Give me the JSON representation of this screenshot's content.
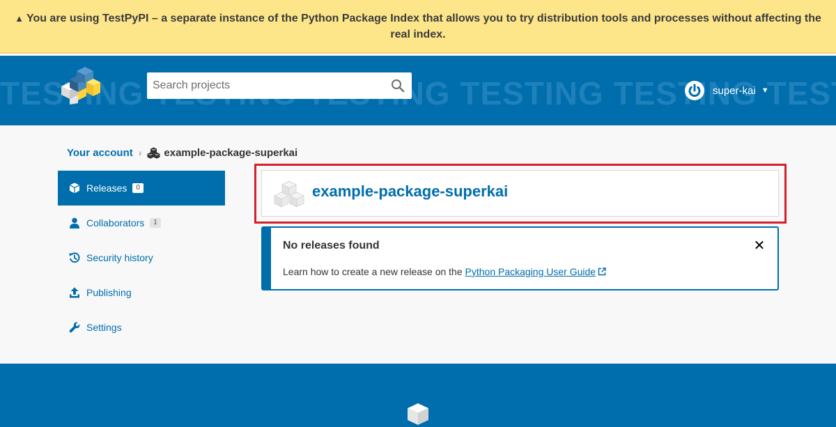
{
  "banner": {
    "icon": "warning-triangle-icon",
    "icon_glyph": "▲",
    "text": "You are using TestPyPI – a separate instance of the Python Package Index that allows you to try distribution tools and processes without affecting the real index."
  },
  "header": {
    "watermark": "TESTING TESTING TESTING TESTING TESTING TESTING",
    "logo_icon": "pypi-logo-icon",
    "search": {
      "placeholder": "Search projects",
      "value": "",
      "icon": "search-icon"
    },
    "user": {
      "icon": "power-icon",
      "name": "super-kai",
      "caret": "▼"
    }
  },
  "breadcrumb": {
    "parent": "Your account",
    "separator": "›",
    "icon": "cubes-icon",
    "current": "example-package-superkai"
  },
  "sidebar": {
    "items": [
      {
        "label": "Releases",
        "icon": "box-icon",
        "badge": "0",
        "active": true
      },
      {
        "label": "Collaborators",
        "icon": "user-icon",
        "badge": "1",
        "active": false
      },
      {
        "label": "Security history",
        "icon": "history-icon",
        "active": false
      },
      {
        "label": "Publishing",
        "icon": "upload-icon",
        "active": false
      },
      {
        "label": "Settings",
        "icon": "wrench-icon",
        "active": false
      }
    ]
  },
  "package": {
    "name": "example-package-superkai",
    "icon": "package-cubes-icon"
  },
  "callout": {
    "title": "No releases found",
    "text": "Learn how to create a new release on the ",
    "link": "Python Packaging User Guide",
    "link_icon": "external-link-icon",
    "close": "✕"
  },
  "footer": {
    "icon": "footer-cube-icon"
  },
  "colors": {
    "banner_bg": "#fde68a",
    "brand_blue": "#006dad",
    "highlight_red": "#d41f2d",
    "page_bg": "#f8f8f8"
  }
}
